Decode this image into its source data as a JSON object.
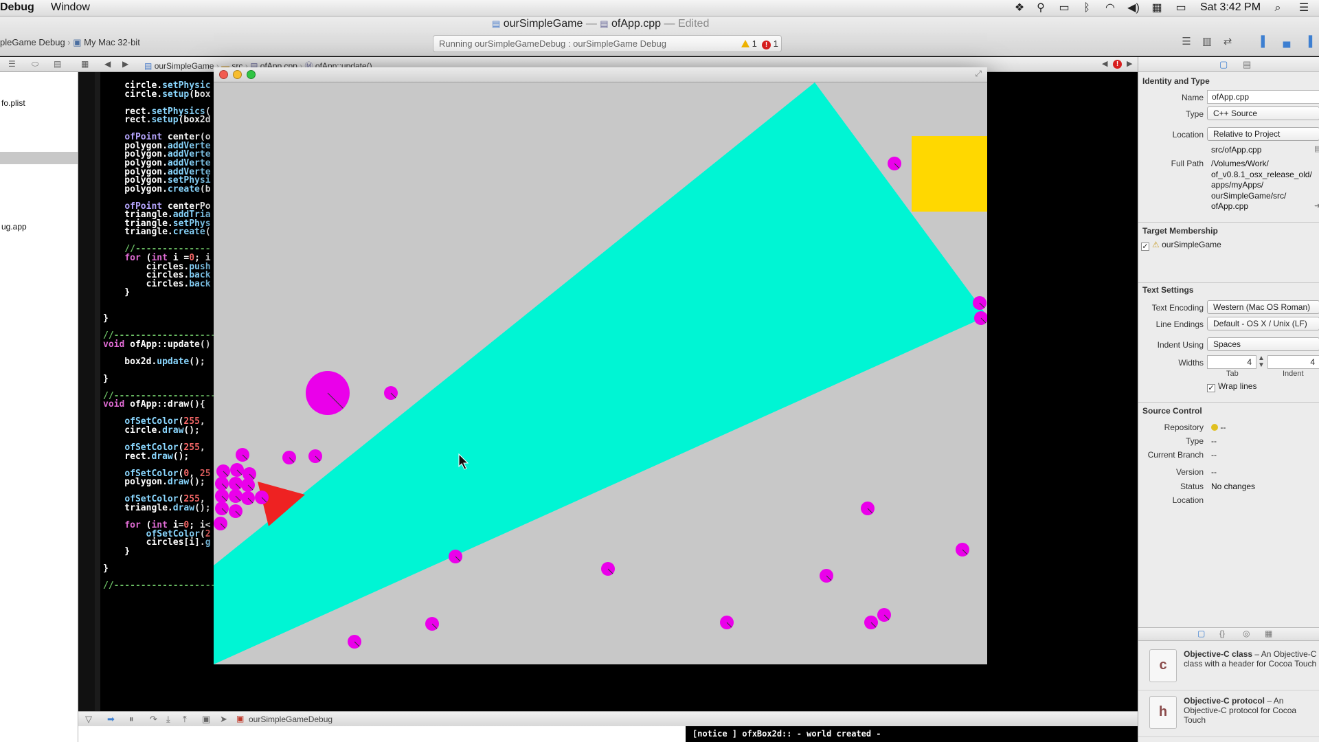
{
  "menubar": {
    "app_name": "Debug",
    "window_menu": "Window",
    "clock": "Sat 3:42 PM"
  },
  "toolbar": {
    "title_project": "ourSimpleGame",
    "title_dash": "—",
    "title_file": "ofApp.cpp",
    "title_edited": "— Edited",
    "scheme_target": "pleGame Debug",
    "scheme_destination": "My Mac 32-bit",
    "activity_text": "Running ourSimpleGameDebug : ourSimpleGame Debug",
    "warning_count": "1",
    "error_count": "1"
  },
  "jumpbar": {
    "crumbs": [
      "ourSimpleGame",
      "src",
      "ofApp.cpp",
      "ofApp::update()"
    ]
  },
  "navigator": {
    "items": [
      "fo.plist",
      "ug.app"
    ]
  },
  "code_lines": [
    "    circle.setPhysic",
    "    circle.setup(box",
    "",
    "    rect.setPhysics(",
    "    rect.setup(box2d",
    "",
    "    ofPoint center(o",
    "    polygon.addVerte",
    "    polygon.addVerte",
    "    polygon.addVerte",
    "    polygon.addVerte",
    "    polygon.setPhysi",
    "    polygon.create(b",
    "",
    "    ofPoint centerPo",
    "    triangle.addTria",
    "    triangle.setPhys",
    "    triangle.create(",
    "",
    "    //--------------",
    "    for (int i =0; i",
    "        circles.push",
    "        circles.back",
    "        circles.back",
    "    }",
    "",
    "",
    "}",
    "",
    "//--------------------",
    "void ofApp::update()",
    "",
    "    box2d.update();",
    "",
    "}",
    "",
    "//--------------------",
    "void ofApp::draw(){",
    "",
    "    ofSetColor(255,",
    "    circle.draw();",
    "",
    "    ofSetColor(255,",
    "    rect.draw();",
    "",
    "    ofSetColor(0, 25",
    "    polygon.draw();",
    "",
    "    ofSetColor(255,",
    "    triangle.draw();",
    "",
    "    for (int i=0; i<",
    "        ofSetColor(2",
    "        circles[i].g",
    "    }",
    "",
    "}",
    "",
    "//------------------------------------------------------------"
  ],
  "debugbar": {
    "process": "ourSimpleGameDebug"
  },
  "console": {
    "output": "[notice ] ofxBox2d:: - world created -"
  },
  "inspector": {
    "identity_header": "Identity and Type",
    "name_label": "Name",
    "name_value": "ofApp.cpp",
    "type_label": "Type",
    "type_value": "C++ Source",
    "location_label": "Location",
    "location_value": "Relative to Project",
    "relative_path": "src/ofApp.cpp",
    "full_path_label": "Full Path",
    "full_path_lines": [
      "/Volumes/Work/",
      "of_v0.8.1_osx_release_old/",
      "apps/myApps/",
      "ourSimpleGame/src/",
      "ofApp.cpp"
    ],
    "target_header": "Target Membership",
    "target_name": "ourSimpleGame",
    "text_header": "Text Settings",
    "encoding_label": "Text Encoding",
    "encoding_value": "Western (Mac OS Roman)",
    "line_endings_label": "Line Endings",
    "line_endings_value": "Default - OS X / Unix (LF)",
    "indent_using_label": "Indent Using",
    "indent_using_value": "Spaces",
    "widths_label": "Widths",
    "tab_value": "4",
    "indent_value": "4",
    "tab_caption": "Tab",
    "indent_caption": "Indent",
    "wrap_label": "Wrap lines",
    "source_header": "Source Control",
    "repository_label": "Repository",
    "repository_value": "--",
    "sc_type_label": "Type",
    "sc_type_value": "--",
    "branch_label": "Current Branch",
    "branch_value": "--",
    "version_label": "Version",
    "version_value": "--",
    "status_label": "Status",
    "status_value": "No changes",
    "sc_location_label": "Location"
  },
  "library": {
    "items": [
      {
        "title": "Objective-C class",
        "desc": " – An Objective-C class with a header for Cocoa Touch"
      },
      {
        "title": "Objective-C protocol",
        "desc": " – An Objective-C protocol for Cocoa Touch"
      }
    ]
  },
  "colors": {
    "polygon": "#00f5d4",
    "rect": "#ffd800",
    "triangle": "#ee2222",
    "circle": "#ea00ea",
    "scene_bg": "#c8c8c8"
  }
}
